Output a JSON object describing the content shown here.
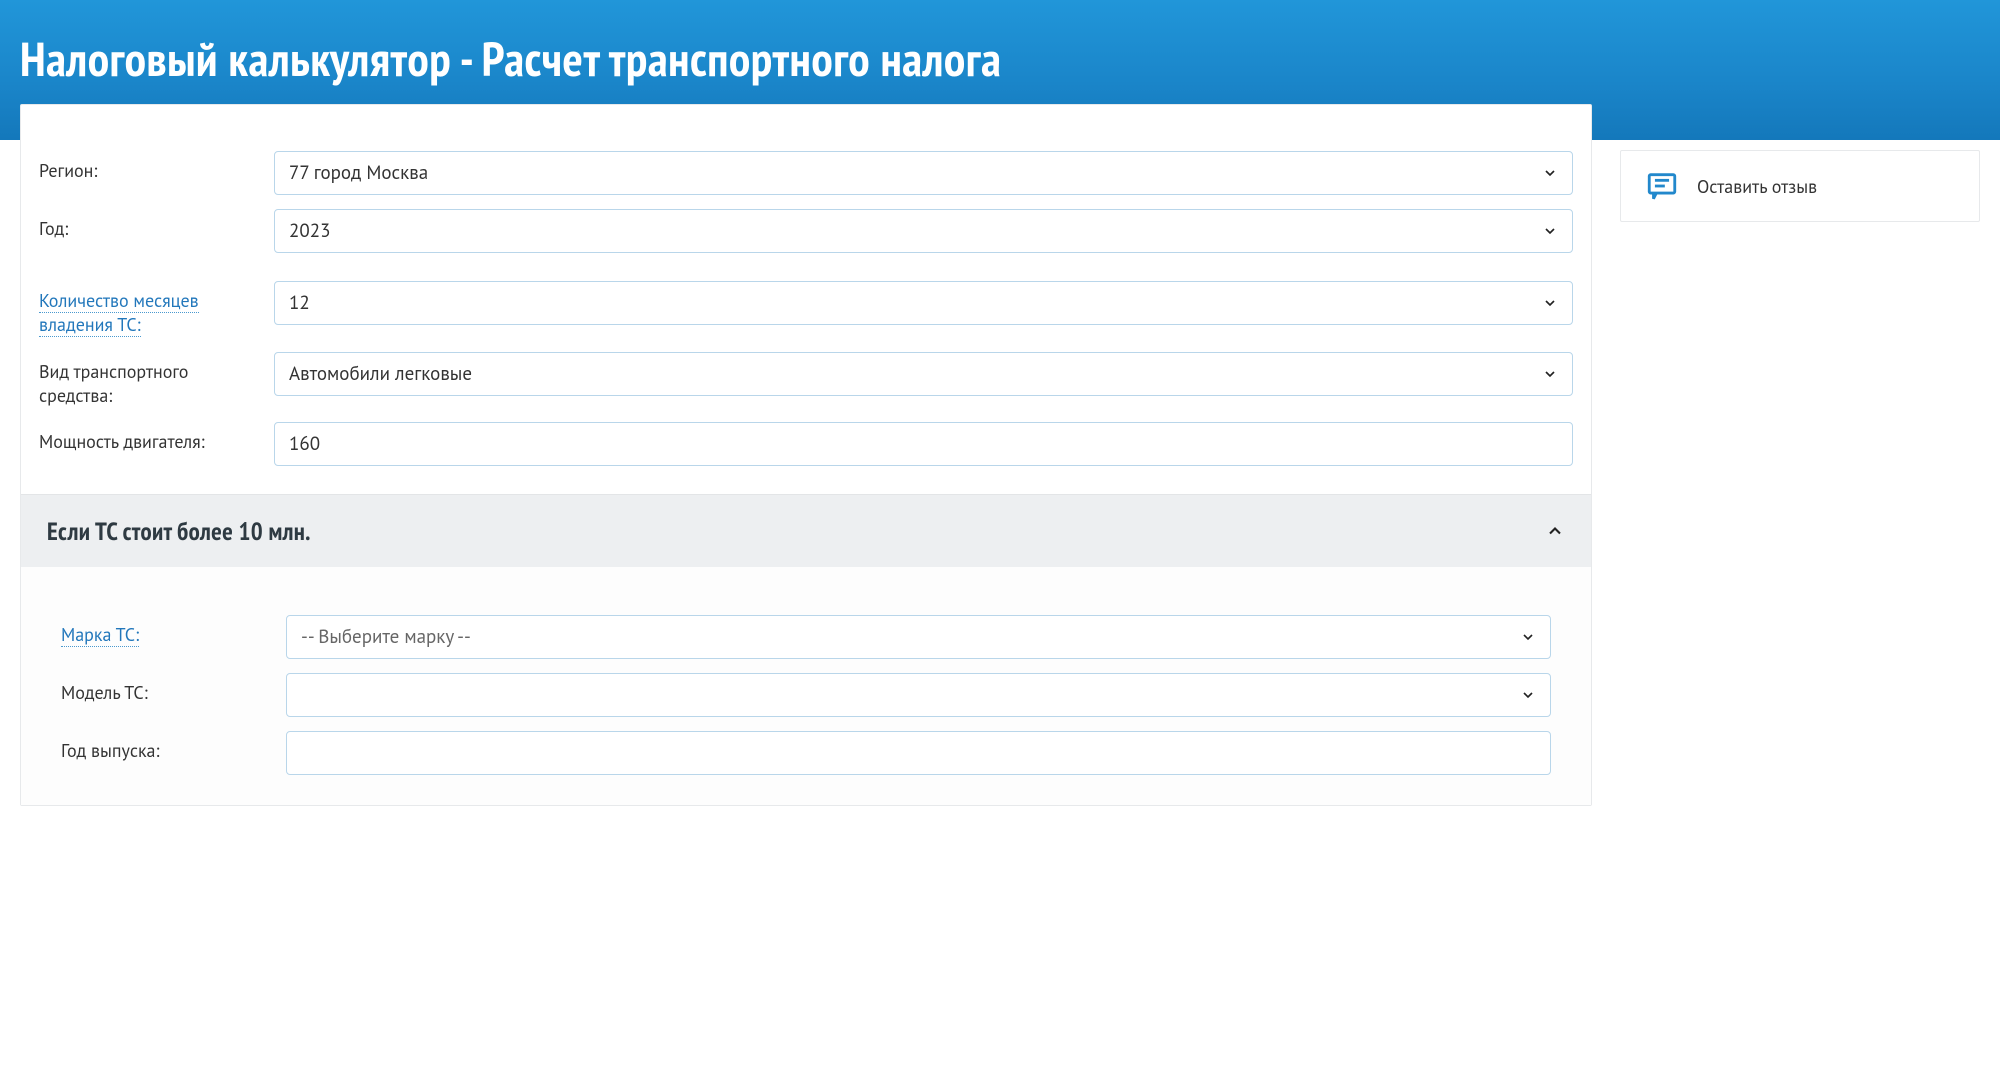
{
  "header": {
    "title": "Налоговый калькулятор - Расчет транспортного налога"
  },
  "feedback": {
    "text": "Оставить отзыв"
  },
  "form": {
    "region": {
      "label": "Регион:",
      "value": "77 город Москва"
    },
    "year": {
      "label": "Год:",
      "value": "2023"
    },
    "months": {
      "label1": "Количество месяцев",
      "label2": "владения ТС:",
      "value": "12"
    },
    "vehicle_type": {
      "label1": "Вид транспортного",
      "label2": "средства:",
      "value": "Автомобили легковые"
    },
    "engine_power": {
      "label": "Мощность двигателя:",
      "value": "160"
    }
  },
  "accordion": {
    "title": "Если ТС стоит более 10 млн.",
    "brand": {
      "label": "Марка ТС:",
      "placeholder": "-- Выберите марку --"
    },
    "model": {
      "label": "Модель ТС:",
      "value": ""
    },
    "prod_year": {
      "label": "Год выпуска:",
      "value": ""
    }
  }
}
